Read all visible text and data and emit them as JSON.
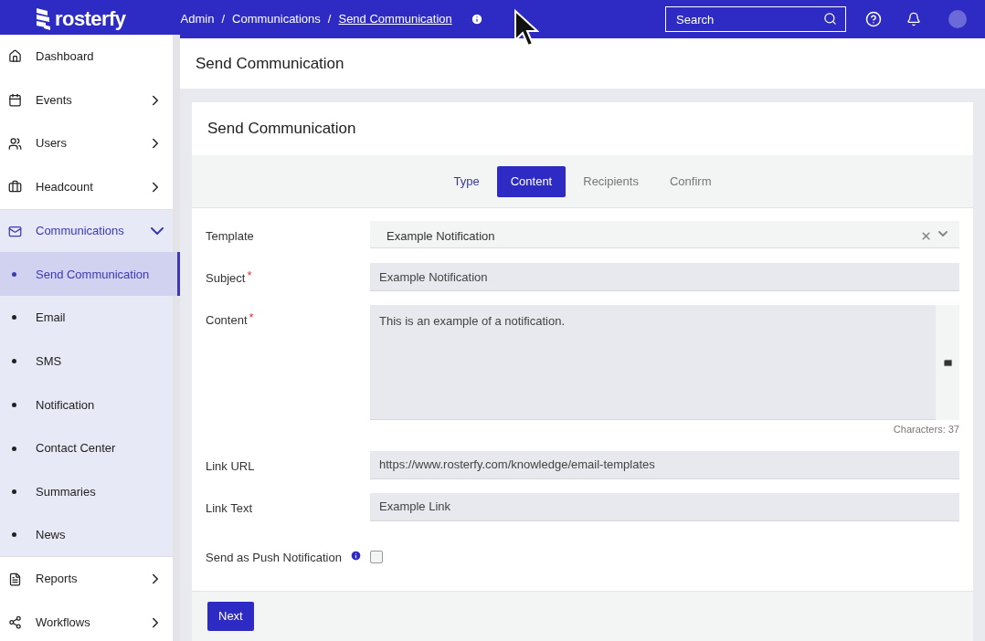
{
  "header": {
    "logo": "rosterfy",
    "breadcrumbs": [
      {
        "label": "Admin",
        "current": false
      },
      {
        "separator": "/",
        "label": "Communications",
        "current": false
      },
      {
        "separator": "/",
        "label": "Send Communication",
        "current": true
      }
    ],
    "search": {
      "placeholder": "Search"
    }
  },
  "sidebar": {
    "items": [
      {
        "label": "Dashboard",
        "has_children": false,
        "selected": false
      },
      {
        "label": "Events",
        "has_children": true,
        "expanded": false,
        "selected": false
      },
      {
        "label": "Users",
        "has_children": true,
        "expanded": false,
        "selected": false
      },
      {
        "label": "Headcount",
        "has_children": true,
        "expanded": false,
        "selected": false
      },
      {
        "label": "Communications",
        "has_children": true,
        "expanded": true,
        "selected": true,
        "children": [
          {
            "label": "Send Communication",
            "selected": true
          },
          {
            "label": "Email",
            "selected": false
          },
          {
            "label": "SMS",
            "selected": false
          },
          {
            "label": "Notification",
            "selected": false
          },
          {
            "label": "Contact Center",
            "selected": false
          },
          {
            "label": "Summaries",
            "selected": false
          },
          {
            "label": "News",
            "selected": false
          }
        ]
      },
      {
        "label": "Reports",
        "has_children": true,
        "expanded": false,
        "selected": false
      },
      {
        "label": "Workflows",
        "has_children": true,
        "expanded": false,
        "selected": false
      }
    ]
  },
  "page_title": "Send Communication",
  "card": {
    "title": "Send Communication",
    "steps": [
      {
        "label": "Type",
        "selected": false,
        "done": true
      },
      {
        "label": "Content",
        "selected": true,
        "done": false
      },
      {
        "label": "Recipients",
        "selected": false,
        "done": false
      },
      {
        "label": "Confirm",
        "selected": false,
        "done": false
      }
    ],
    "fields": [
      {
        "kind": "select",
        "label": "Template",
        "value": "Example Notification"
      },
      {
        "kind": "text",
        "label": "Subject",
        "required_mark": "*",
        "value": "Example Notification"
      },
      {
        "kind": "textarea",
        "label": "Content",
        "required_mark": "*",
        "value": "This is an example of a notification.",
        "counter": "Characters: 37"
      },
      {
        "kind": "text",
        "label": "Link URL",
        "value": "https://www.rosterfy.com/knowledge/email-templates"
      },
      {
        "kind": "text",
        "label": "Link Text",
        "value": "Example Link"
      },
      {
        "kind": "checkbox",
        "label": "Send as Push Notification",
        "checked": false
      }
    ],
    "next_button": "Next"
  }
}
